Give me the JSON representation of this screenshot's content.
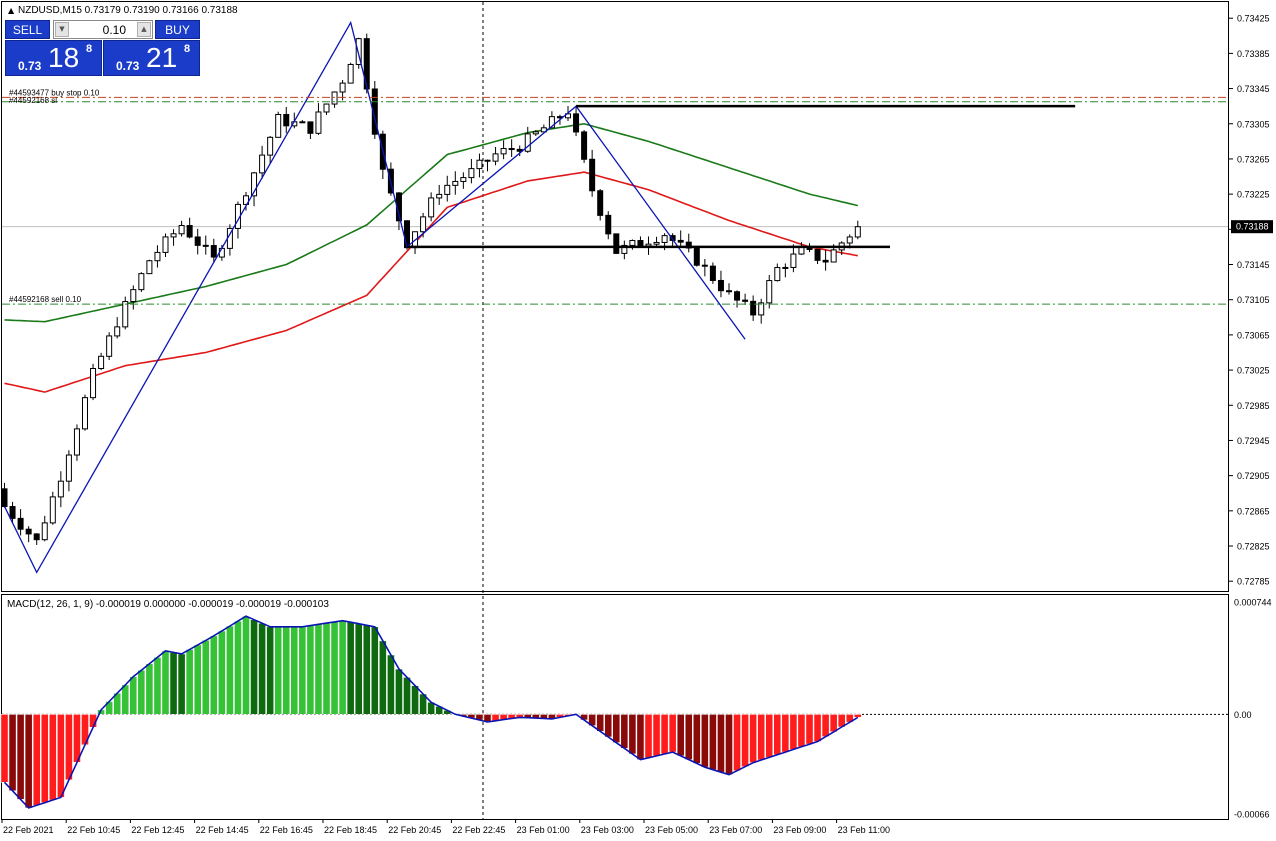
{
  "header": {
    "symbol_line": "NZDUSD,M15  0.73179 0.73190 0.73166 0.73188"
  },
  "trade_panel": {
    "sell_label": "SELL",
    "buy_label": "BUY",
    "lot_value": "0.10",
    "sell_prefix": "0.73",
    "sell_big": "18",
    "sell_sup": "8",
    "buy_prefix": "0.73",
    "buy_big": "21",
    "buy_sup": "8"
  },
  "orders": [
    {
      "label": "#44593477 buy stop 0.10",
      "price": 0.73335,
      "color": "#c8401e"
    },
    {
      "label": "#44592168 sl",
      "price": 0.7333,
      "color": "#2a8a2a"
    },
    {
      "label": "#44592168 sell 0.10",
      "price": 0.731,
      "color": "#2a8a2a"
    }
  ],
  "current_price": "0.73188",
  "macd": {
    "label": "MACD(12, 26, 1, 9) -0.000019 0.000000 -0.000019 -0.000019 -0.000103",
    "axis_labels": [
      "0.000744",
      "0.00",
      "-0.00066"
    ]
  },
  "colors": {
    "ma_green": "#1a7a1a",
    "ma_red": "#e01818",
    "zigzag": "#0a14b4",
    "hist_up_light": "#36c236",
    "hist_up_dark": "#0e6a0e",
    "hist_down_light": "#ff1c1c",
    "hist_down_dark": "#8a0a0a",
    "trade_blue": "#1a3cc8"
  },
  "chart_data": {
    "type": "candlestick",
    "symbol": "NZDUSD",
    "timeframe": "M15",
    "ylim": [
      0.72775,
      0.7344
    ],
    "y_ticks": [
      "0.73425",
      "0.73385",
      "0.73345",
      "0.73305",
      "0.73265",
      "0.73225",
      "0.73185",
      "0.73145",
      "0.73105",
      "0.73065",
      "0.73025",
      "0.72985",
      "0.72945",
      "0.72905",
      "0.72865",
      "0.72825",
      "0.72785"
    ],
    "x_ticks": [
      "22 Feb 2021",
      "22 Feb 10:45",
      "22 Feb 12:45",
      "22 Feb 14:45",
      "22 Feb 16:45",
      "22 Feb 18:45",
      "22 Feb 20:45",
      "22 Feb 22:45",
      "23 Feb 01:00",
      "23 Feb 03:00",
      "23 Feb 05:00",
      "23 Feb 07:00",
      "23 Feb 09:00",
      "23 Feb 11:00"
    ],
    "candle_count": 107,
    "close_anchors": [
      [
        0,
        0.7287
      ],
      [
        4,
        0.7283
      ],
      [
        7,
        0.72905
      ],
      [
        11,
        0.7302
      ],
      [
        14,
        0.7308
      ],
      [
        18,
        0.7315
      ],
      [
        22,
        0.7319
      ],
      [
        26,
        0.7315
      ],
      [
        30,
        0.7323
      ],
      [
        34,
        0.7331
      ],
      [
        38,
        0.733
      ],
      [
        42,
        0.73355
      ],
      [
        44,
        0.734
      ],
      [
        47,
        0.7325
      ],
      [
        50,
        0.7317
      ],
      [
        54,
        0.7323
      ],
      [
        58,
        0.7325
      ],
      [
        61,
        0.7327
      ],
      [
        64,
        0.7328
      ],
      [
        67,
        0.733
      ],
      [
        70,
        0.7332
      ],
      [
        73,
        0.7323
      ],
      [
        76,
        0.7316
      ],
      [
        79,
        0.7317
      ],
      [
        82,
        0.7318
      ],
      [
        86,
        0.7315
      ],
      [
        90,
        0.7311
      ],
      [
        93,
        0.7309
      ],
      [
        96,
        0.7314
      ],
      [
        99,
        0.7316
      ],
      [
        102,
        0.7315
      ],
      [
        104,
        0.7317
      ],
      [
        106,
        0.73188
      ]
    ],
    "zigzag": [
      [
        0,
        0.7287
      ],
      [
        4,
        0.72795
      ],
      [
        43,
        0.7342
      ],
      [
        50,
        0.73165
      ],
      [
        71,
        0.73325
      ],
      [
        92,
        0.7306
      ]
    ],
    "hlines": [
      {
        "from": 71,
        "to": 133,
        "price": 0.73325
      },
      {
        "from": 50,
        "to": 110,
        "price": 0.73165
      }
    ],
    "ma_green_anchors": [
      [
        0,
        0.73082
      ],
      [
        5,
        0.7308
      ],
      [
        15,
        0.731
      ],
      [
        25,
        0.7312
      ],
      [
        35,
        0.73145
      ],
      [
        45,
        0.7319
      ],
      [
        55,
        0.7327
      ],
      [
        65,
        0.73295
      ],
      [
        72,
        0.73305
      ],
      [
        80,
        0.73285
      ],
      [
        90,
        0.73255
      ],
      [
        100,
        0.73225
      ],
      [
        106,
        0.73212
      ]
    ],
    "ma_red_anchors": [
      [
        0,
        0.7301
      ],
      [
        5,
        0.73
      ],
      [
        15,
        0.7303
      ],
      [
        25,
        0.73045
      ],
      [
        35,
        0.7307
      ],
      [
        45,
        0.7311
      ],
      [
        55,
        0.7321
      ],
      [
        65,
        0.7324
      ],
      [
        72,
        0.7325
      ],
      [
        80,
        0.7323
      ],
      [
        90,
        0.73195
      ],
      [
        100,
        0.73165
      ],
      [
        106,
        0.73155
      ]
    ],
    "macd_ylim": [
      -0.00066,
      0.000744
    ],
    "macd_hist_anchors": [
      [
        0,
        -0.00045
      ],
      [
        3,
        -0.00062
      ],
      [
        7,
        -0.00055
      ],
      [
        12,
        3e-05
      ],
      [
        16,
        0.00025
      ],
      [
        20,
        0.00042
      ],
      [
        22,
        0.0004
      ],
      [
        26,
        0.00052
      ],
      [
        30,
        0.00065
      ],
      [
        33,
        0.00058
      ],
      [
        37,
        0.00058
      ],
      [
        42,
        0.00062
      ],
      [
        46,
        0.00058
      ],
      [
        49,
        0.0003
      ],
      [
        53,
        8e-05
      ],
      [
        56,
        0.0
      ],
      [
        60,
        -5e-05
      ],
      [
        64,
        -2e-05
      ],
      [
        68,
        -3e-05
      ],
      [
        71,
        0.0
      ],
      [
        75,
        -0.00015
      ],
      [
        79,
        -0.0003
      ],
      [
        83,
        -0.00025
      ],
      [
        87,
        -0.00035
      ],
      [
        90,
        -0.0004
      ],
      [
        93,
        -0.00032
      ],
      [
        97,
        -0.00025
      ],
      [
        101,
        -0.00018
      ],
      [
        106,
        -2e-05
      ]
    ]
  }
}
